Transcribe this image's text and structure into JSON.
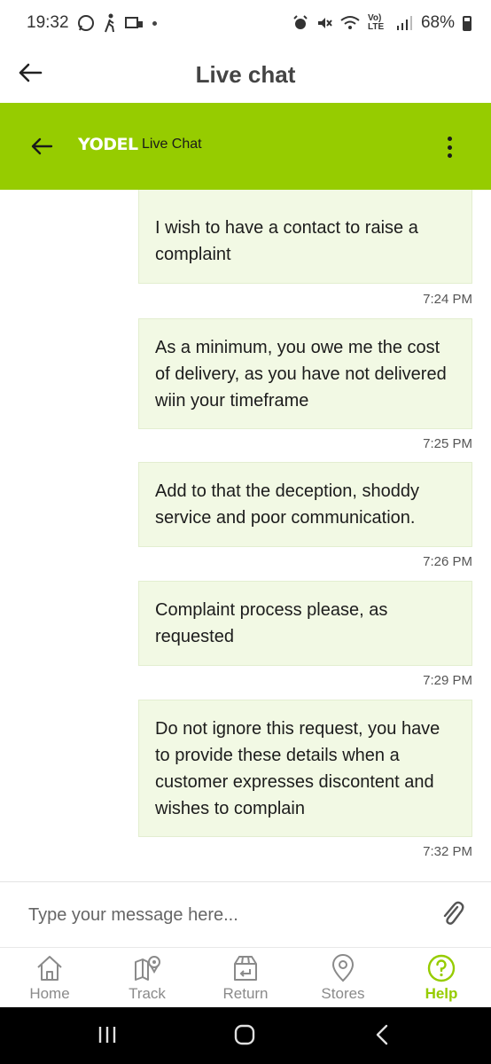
{
  "status_bar": {
    "time": "19:32",
    "battery": "68%",
    "network": "Vo) LTE"
  },
  "app_bar": {
    "title": "Live chat"
  },
  "chat_header": {
    "brand": "YODEL",
    "title": "Live Chat"
  },
  "messages": [
    {
      "text": "I wish to have a contact to raise a complaint",
      "time": "7:24 PM"
    },
    {
      "text": "As a minimum, you owe me the cost of delivery, as you have not delivered wiin your timeframe",
      "time": "7:25 PM"
    },
    {
      "text": "Add to that the deception, shoddy service and poor communication.",
      "time": "7:26 PM"
    },
    {
      "text": "Complaint process please, as requested",
      "time": "7:29 PM"
    },
    {
      "text": "Do not ignore this request, you have to provide these details when a customer expresses discontent and wishes to complain",
      "time": "7:32 PM"
    }
  ],
  "input": {
    "placeholder": "Type your message here..."
  },
  "bottom_nav": {
    "items": [
      {
        "label": "Home",
        "icon": "home-icon"
      },
      {
        "label": "Track",
        "icon": "map-pin-icon"
      },
      {
        "label": "Return",
        "icon": "return-box-icon"
      },
      {
        "label": "Stores",
        "icon": "location-icon"
      },
      {
        "label": "Help",
        "icon": "help-icon",
        "active": true
      }
    ]
  },
  "colors": {
    "brand_green": "#96cc00",
    "bubble_bg": "#f2f9e4"
  }
}
